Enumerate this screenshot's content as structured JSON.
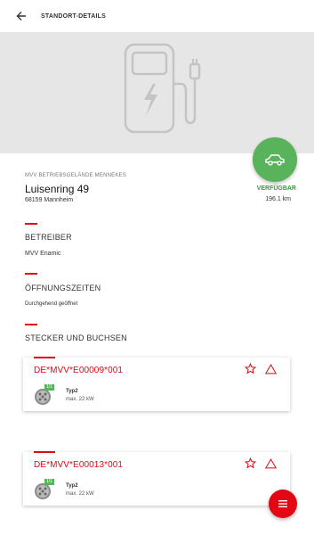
{
  "appbar": {
    "title": "STANDORT-DETAILS"
  },
  "location": {
    "operator_label": "MVV BETRIEBSGELÄNDE MENNEKES",
    "street": "Luisenring 49",
    "city": "68159 Mannheim",
    "status": "VERFÜGBAR",
    "distance": "196.1 km"
  },
  "sections": {
    "betreiber": {
      "title": "BETREIBER",
      "value": "MVV Enamic"
    },
    "oeffnungszeiten": {
      "title": "ÖFFNUNGSZEITEN",
      "value": "Durchgehend geöffnet"
    },
    "stecker": {
      "title": "STECKER UND BUCHSEN"
    }
  },
  "connectors": [
    {
      "id": "DE*MVV*E00009*001",
      "type": "Typ2",
      "max": "max. 22 kW",
      "badge": "1/1"
    },
    {
      "id": "DE*MVV*E00013*001",
      "type": "Typ2",
      "max": "max. 22 kW",
      "badge": "1/1"
    }
  ],
  "colors": {
    "accent": "#e30613",
    "available": "#59b35a",
    "hero_bg": "#e6e6e6"
  },
  "icons": {
    "back": "arrow-left-icon",
    "station": "charging-station-icon",
    "car": "car-icon",
    "star": "star-outline-icon",
    "warning": "warning-triangle-icon",
    "plug": "type2-plug-icon",
    "menu": "menu-icon"
  }
}
